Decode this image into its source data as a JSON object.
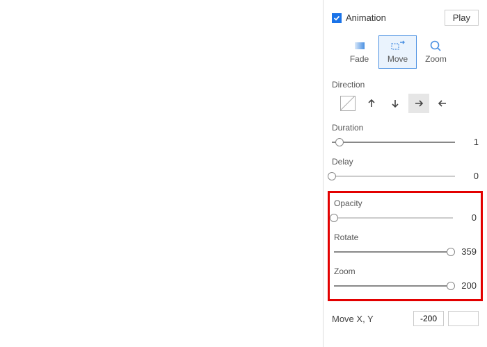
{
  "header": {
    "checkbox_label": "Animation",
    "checkbox_checked": true,
    "play_label": "Play"
  },
  "modes": {
    "items": [
      {
        "id": "fade",
        "label": "Fade",
        "active": false
      },
      {
        "id": "move",
        "label": "Move",
        "active": true
      },
      {
        "id": "zoom",
        "label": "Zoom",
        "active": false
      }
    ]
  },
  "direction": {
    "label": "Direction",
    "selected": "right"
  },
  "sliders": {
    "duration": {
      "label": "Duration",
      "value": 1,
      "pct": 6
    },
    "delay": {
      "label": "Delay",
      "value": 0,
      "pct": 0
    },
    "opacity": {
      "label": "Opacity",
      "value": 0,
      "pct": 0
    },
    "rotate": {
      "label": "Rotate",
      "value": 359,
      "pct": 98
    },
    "zoom": {
      "label": "Zoom",
      "value": 200,
      "pct": 98
    }
  },
  "move": {
    "label": "Move X, Y",
    "x": "-200",
    "y": ""
  }
}
